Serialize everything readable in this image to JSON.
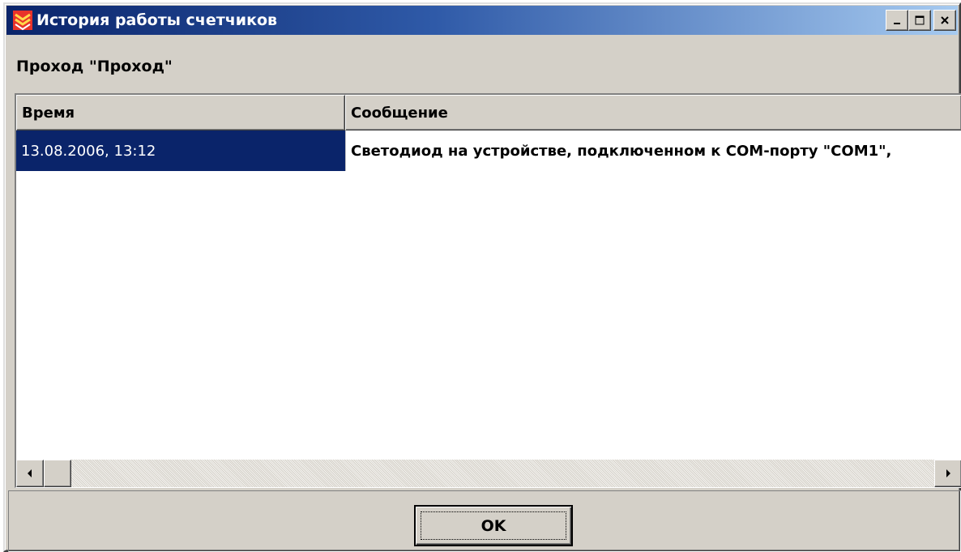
{
  "window": {
    "title": "История работы счетчиков",
    "icon": "app-shield-icon",
    "controls": {
      "minimize": "minimize-icon",
      "maximize": "maximize-icon",
      "close": "close-icon"
    }
  },
  "section": {
    "label": "Проход \"Проход\""
  },
  "table": {
    "columns": [
      "Время",
      "Сообщение"
    ],
    "rows": [
      {
        "time": "13.08.2006, 13:12",
        "message": "Светодиод на устройстве, подключенном к COM-порту \"COM1\", "
      }
    ]
  },
  "buttons": {
    "ok": "OK"
  },
  "colors": {
    "selection": "#0a246a",
    "titlebar_start": "#0a246a",
    "titlebar_end": "#a6caf0",
    "face": "#d4d0c8"
  }
}
